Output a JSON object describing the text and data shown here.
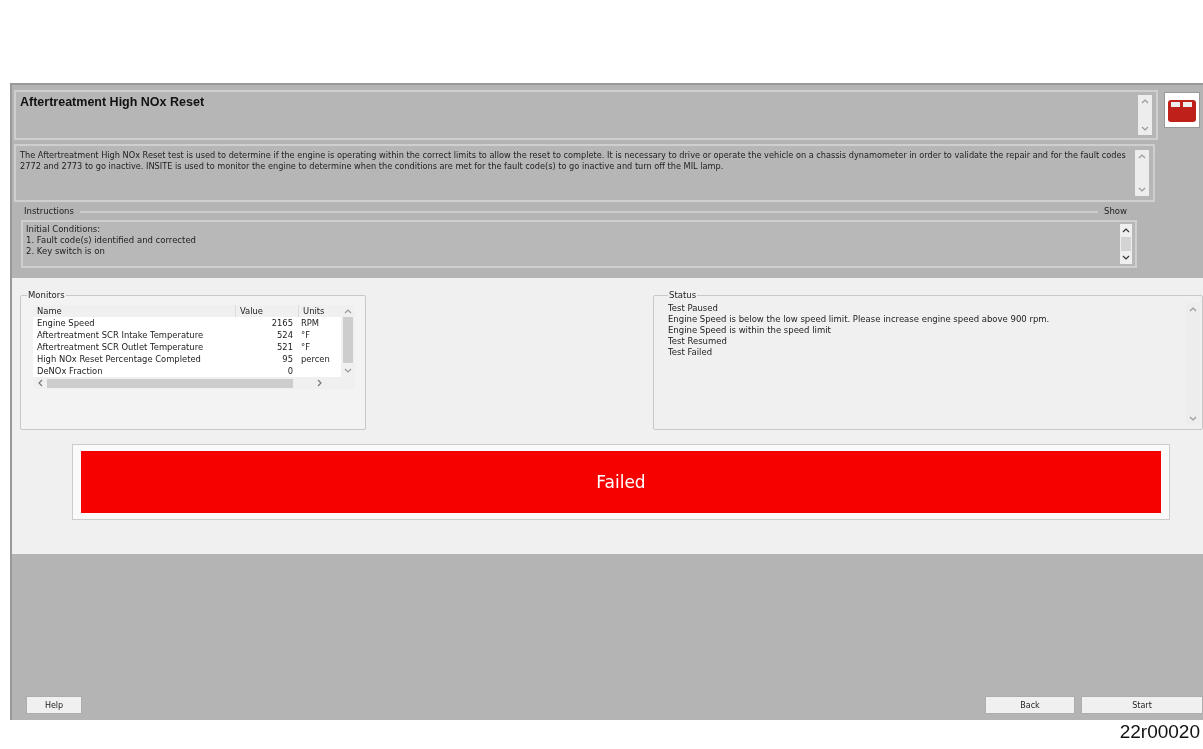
{
  "window": {
    "title": "Aftertreatment High NOx Reset"
  },
  "description": "The Aftertreatment High NOx Reset test is used to determine if the engine is operating within the correct limits to allow the reset to complete. It is necessary to drive or operate the vehicle on a chassis dynamometer in order to validate the repair and for the fault codes 2772 and 2773 to go inactive. INSITE is used to monitor the engine to determine when the conditions are met for the fault code(s) to go inactive and turn off the MIL lamp.",
  "instructions": {
    "label": "Instructions",
    "toggle": "Show",
    "lines": [
      "Initial Conditions:",
      "1. Fault code(s) identified and corrected",
      "2. Key switch is on"
    ]
  },
  "monitors": {
    "label": "Monitors",
    "columns": [
      "Name",
      "Value",
      "Units"
    ],
    "rows": [
      {
        "name": "Engine Speed",
        "value": "2165",
        "units": "RPM"
      },
      {
        "name": "Aftertreatment SCR Intake Temperature",
        "value": "524",
        "units": "°F"
      },
      {
        "name": "Aftertreatment SCR Outlet Temperature",
        "value": "521",
        "units": "°F"
      },
      {
        "name": "High NOx Reset Percentage Completed",
        "value": "95",
        "units": "percen"
      },
      {
        "name": "DeNOx Fraction",
        "value": "0",
        "units": ""
      }
    ]
  },
  "status": {
    "label": "Status",
    "lines": [
      "Test Paused",
      "Engine Speed is below the low speed limit. Please increase engine speed above 900 rpm.",
      "Engine Speed is within the speed limit",
      "Test Resumed",
      "Test Failed"
    ]
  },
  "result": {
    "text": "Failed"
  },
  "buttons_left": [
    "Help"
  ],
  "buttons_right": [
    "Back",
    "Start"
  ],
  "figure_id": "22r00020"
}
